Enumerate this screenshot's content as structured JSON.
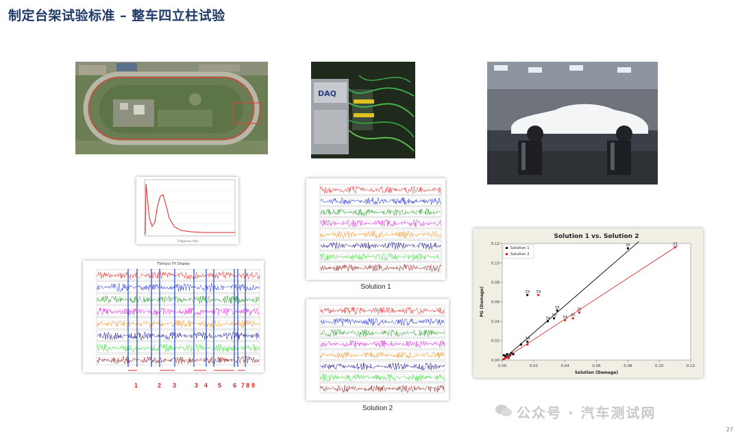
{
  "title": "制定台架试验标准 – 整车四立柱试验",
  "page_number": "27",
  "watermark": "公众号 · 汽车测试网",
  "solution1_caption": "Solution 1",
  "solution2_caption": "Solution 2",
  "segment_labels": [
    "1",
    "2",
    "3",
    "3",
    "4",
    "5",
    "6",
    "7",
    "8",
    "9"
  ],
  "tsimpul_title": "TSImpul XY Display",
  "rainflow_title": "Solution 1 vs. Solution 2",
  "colors": {
    "title": "#1f3a68",
    "segment": "#e02020",
    "solution1": "#000000",
    "solution2": "#e02020"
  },
  "chart_data": {
    "type": "scatter",
    "title": "Solution 1 vs. Solution 2",
    "xlabel": "Solution (Damage)",
    "ylabel": "PG (Damage)",
    "xlim": [
      0,
      0.12
    ],
    "ylim": [
      0,
      0.12
    ],
    "xticks": [
      "0.00",
      "0.02",
      "0.04",
      "0.06",
      "0.08",
      "0.10",
      "0.12"
    ],
    "yticks": [
      "0.00",
      "0.02",
      "0.04",
      "0.06",
      "0.08",
      "0.10",
      "0.12"
    ],
    "legend_position": "top-left",
    "series": [
      {
        "name": "Solution 1",
        "color": "#000000",
        "points": [
          [
            0.001,
            0.005
          ],
          [
            0.002,
            0.004
          ],
          [
            0.003,
            0.006
          ],
          [
            0.004,
            0.003
          ],
          [
            0.005,
            0.005
          ],
          [
            0.006,
            0.007
          ],
          [
            0.007,
            0.006
          ],
          [
            0.012,
            0.016
          ],
          [
            0.016,
            0.019
          ],
          [
            0.029,
            0.04
          ],
          [
            0.033,
            0.043
          ],
          [
            0.035,
            0.051
          ],
          [
            0.016,
            0.067
          ],
          [
            0.08,
            0.115
          ]
        ],
        "labels": [
          "",
          "",
          "",
          "",
          "",
          "",
          "",
          "",
          "38",
          "34",
          "30",
          "35",
          "39",
          "35"
        ],
        "trend": [
          [
            0,
            0
          ],
          [
            0.087,
            0.122
          ]
        ]
      },
      {
        "name": "Solution 2",
        "color": "#e02020",
        "points": [
          [
            0.001,
            0.001
          ],
          [
            0.002,
            0.002
          ],
          [
            0.003,
            0.003
          ],
          [
            0.004,
            0.002
          ],
          [
            0.016,
            0.016
          ],
          [
            0.04,
            0.041
          ],
          [
            0.045,
            0.043
          ],
          [
            0.049,
            0.049
          ],
          [
            0.023,
            0.067
          ],
          [
            0.11,
            0.116
          ]
        ],
        "labels": [
          "",
          "",
          "",
          "",
          "",
          "34",
          "30",
          "35",
          "39",
          "33"
        ],
        "trend": [
          [
            0,
            0
          ],
          [
            0.112,
            0.118
          ]
        ]
      }
    ]
  }
}
